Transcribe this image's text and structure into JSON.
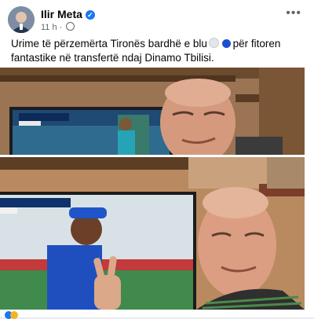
{
  "post": {
    "author": "Ilir Meta",
    "time": "11 h",
    "separator": "·",
    "text_part1": "Urime të përzemërta Tironës bardhë e blu",
    "text_part2": "për fitoren fantastike në transfertë ndaj Dinamo Tbilisi."
  },
  "icons": {
    "verified": "verified-badge-icon",
    "privacy": "globe-icon",
    "more": "more-options-icon",
    "white_circle": "white-circle-emoji",
    "blue_circle": "blue-circle-emoji"
  },
  "more_label": "•••",
  "colors": {
    "accent": "#1877f2",
    "text": "#050505",
    "secondary": "#65676b"
  }
}
